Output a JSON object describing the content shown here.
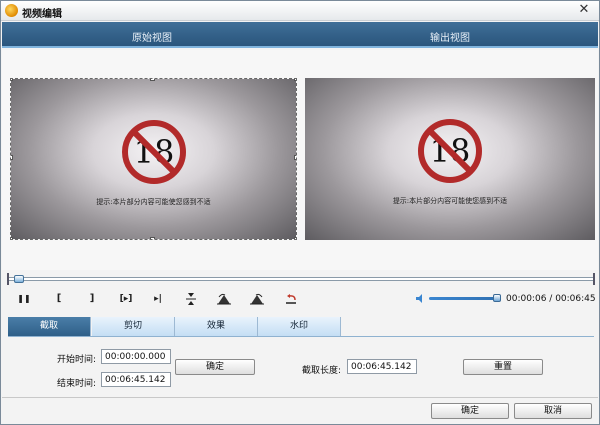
{
  "window": {
    "title": "视频编辑",
    "close_glyph": "✕"
  },
  "header": {
    "left_label": "原始视图",
    "right_label": "输出视图"
  },
  "preview": {
    "warning_text": "提示:本片部分内容可能使您感到不适",
    "badge_text": "18"
  },
  "timeline": {
    "position_fraction": 0.01
  },
  "controls": {
    "pause_glyph": "❚❚",
    "mark_in_glyph": "[",
    "mark_out_glyph": "]",
    "play_segment_glyph": "[▸]",
    "next_glyph": "▸|",
    "volume_fraction": 0.9,
    "time_current": "00:00:06",
    "time_separator": " / ",
    "time_total": "00:06:45"
  },
  "tabs": [
    {
      "label": "截取",
      "active": true
    },
    {
      "label": "剪切",
      "active": false
    },
    {
      "label": "效果",
      "active": false
    },
    {
      "label": "水印",
      "active": false
    }
  ],
  "trim": {
    "start_label": "开始时间:",
    "start_value": "00:00:00.000",
    "end_label": "结束时间:",
    "end_value": "00:06:45.142",
    "confirm_label": "确定",
    "length_label": "截取长度:",
    "length_value": "00:06:45.142",
    "reset_label": "重置"
  },
  "footer": {
    "ok_label": "确定",
    "cancel_label": "取消"
  },
  "colors": {
    "header_blue": "#2f5f88",
    "accent": "#3a86d1",
    "no_sign_red": "#b22a2a"
  }
}
